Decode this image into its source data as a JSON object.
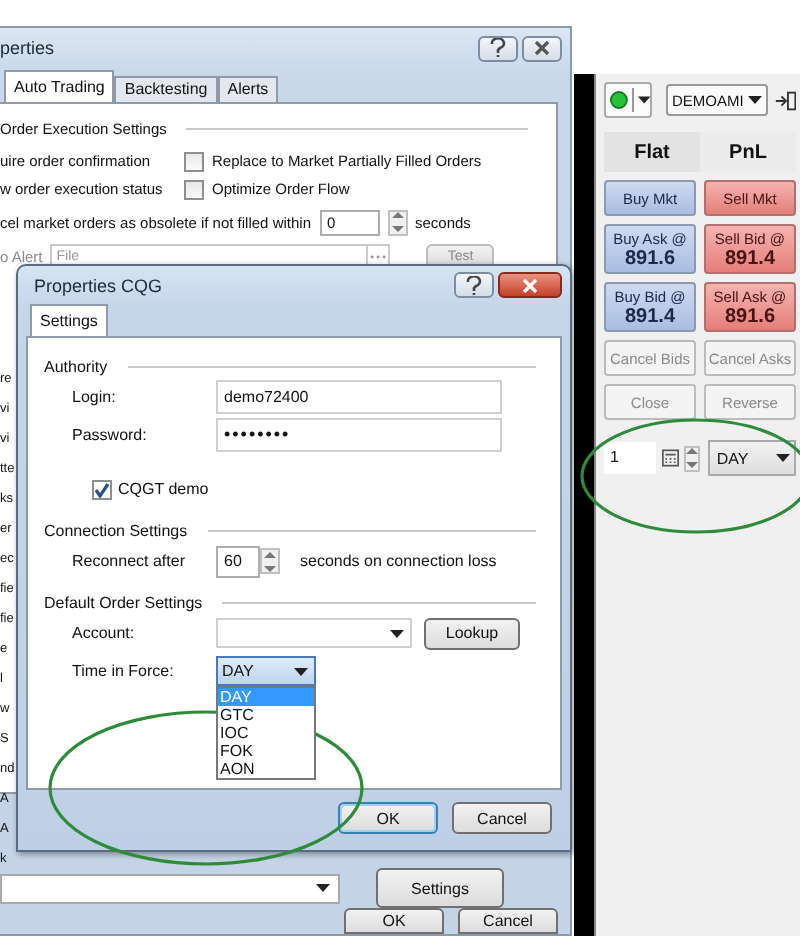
{
  "back_dialog": {
    "title": "perties",
    "tabs": [
      {
        "label": "Auto Trading",
        "selected": true
      },
      {
        "label": "Backtesting",
        "selected": false
      },
      {
        "label": "Alerts",
        "selected": false
      }
    ],
    "section": "Order Execution Settings",
    "left_options": [
      "uire order confirmation",
      "w order execution status"
    ],
    "right_options": [
      {
        "label": "Replace to Market Partially Filled Orders",
        "checked": false
      },
      {
        "label": "Optimize Order Flow",
        "checked": false
      }
    ],
    "obsolete": {
      "label": "cel market orders as obsolete if not filled within",
      "value": "0",
      "unit": "seconds"
    },
    "alert": {
      "label": "o Alert",
      "placeholder": "File",
      "button": "Test",
      "disabled": true
    },
    "obscured_labels": [
      "re",
      "vi",
      "vi",
      "tte",
      "ks",
      "er",
      "ec",
      "fie",
      "fie",
      "e",
      "l",
      "w",
      "S",
      "nd",
      "A",
      "A",
      "k"
    ],
    "settings_button": "Settings",
    "buttons": [
      "OK",
      "Cancel"
    ]
  },
  "cqg_dialog": {
    "title": "Properties CQG",
    "tabs": [
      {
        "label": "Settings",
        "selected": true
      }
    ],
    "authority": {
      "heading": "Authority",
      "login_label": "Login:",
      "login": "demo72400",
      "password_label": "Password:",
      "password": "••••••••",
      "demo": {
        "label": "CQGT demo",
        "checked": true
      }
    },
    "connection": {
      "heading": "Connection Settings",
      "label": "Reconnect after",
      "value": "60",
      "unit": "seconds on connection loss"
    },
    "order": {
      "heading": "Default Order Settings",
      "account_label": "Account:",
      "lookup": "Lookup",
      "tif_label": "Time in Force:",
      "tif": "DAY",
      "tif_options": [
        {
          "label": "DAY",
          "selected": true
        },
        {
          "label": "GTC",
          "selected": false
        },
        {
          "label": "IOC",
          "selected": false
        },
        {
          "label": "FOK",
          "selected": false
        },
        {
          "label": "AON",
          "selected": false
        }
      ]
    },
    "buttons": [
      "OK",
      "Cancel"
    ]
  },
  "trading_panel": {
    "connected": true,
    "account": "DEMOAMI",
    "position": "Flat",
    "pnl": "PnL",
    "buttons": [
      {
        "label": "Buy Mkt",
        "kind": "buy",
        "disabled": false
      },
      {
        "label": "Sell Mkt",
        "kind": "sell",
        "disabled": false
      },
      {
        "label": "Buy Ask @",
        "price": "891.6",
        "kind": "buy",
        "disabled": false
      },
      {
        "label": "Sell Bid @",
        "price": "891.4",
        "kind": "sell",
        "disabled": false
      },
      {
        "label": "Buy Bid @",
        "price": "891.4",
        "kind": "buy",
        "disabled": false
      },
      {
        "label": "Sell Ask @",
        "price": "891.6",
        "kind": "sell",
        "disabled": false
      },
      {
        "label": "Cancel Bids",
        "kind": "neutral",
        "disabled": true
      },
      {
        "label": "Cancel Asks",
        "kind": "neutral",
        "disabled": true
      },
      {
        "label": "Close",
        "kind": "neutral",
        "disabled": true
      },
      {
        "label": "Reverse",
        "kind": "neutral",
        "disabled": true
      }
    ],
    "quantity": "1",
    "tif": "DAY"
  }
}
